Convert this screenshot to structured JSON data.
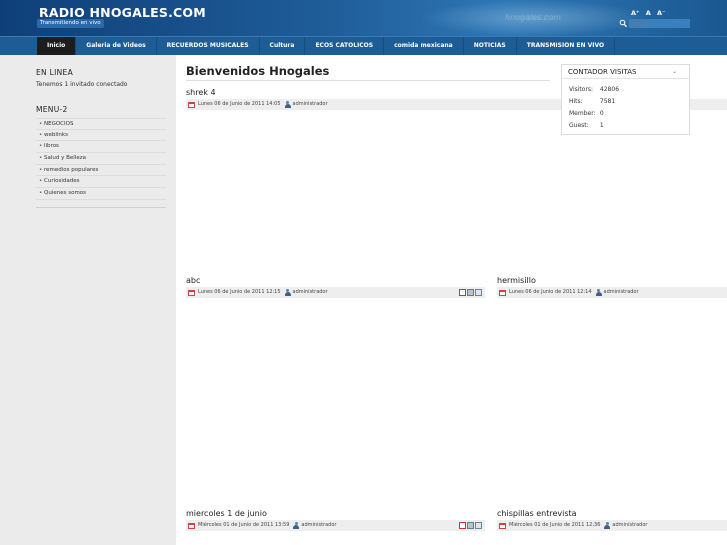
{
  "header": {
    "site_title": "RADIO HNOGALES.COM",
    "tagline": "Transmitiendo en vivo",
    "watermark": "hnogales.com",
    "font_sizer": [
      "A⁺",
      "A",
      "A⁻"
    ],
    "search_placeholder": "buscar...",
    "colors": {
      "header_dark": "#0f3f78",
      "header_light": "#2f77b5",
      "nav": "#1e5c96",
      "nav_active": "#1d1d1d"
    }
  },
  "nav": {
    "items": [
      {
        "label": "Inicio"
      },
      {
        "label": "Galeria de Videos"
      },
      {
        "label": "RECUERDOS MUSICALES"
      },
      {
        "label": "Cultura"
      },
      {
        "label": "ECOS CATOLICOS"
      },
      {
        "label": "comida mexicana"
      },
      {
        "label": "NOTICIAS"
      },
      {
        "label": "TRANSMISION EN VIVO"
      }
    ]
  },
  "sidebar": {
    "online_heading": "EN LINEA",
    "online_text": "Tenemos 1 invitado conectado",
    "menu_heading": "MENU-2",
    "menu_items": [
      {
        "label": "NEGOCIOS"
      },
      {
        "label": "weblinks"
      },
      {
        "label": "libros"
      },
      {
        "label": "Salud y Belleza"
      },
      {
        "label": "remedios populares"
      },
      {
        "label": "Curiosidades"
      },
      {
        "label": "Quienes somos"
      }
    ]
  },
  "main": {
    "page_title": "Bienvenidos Hnogales",
    "articles": [
      {
        "title": "shrek 4",
        "date": "Lunes 06 de Junio de 2011 14:05",
        "author": "administrador"
      },
      {
        "title": "abc",
        "date": "Lunes 06 de Junio de 2011 12:15",
        "author": "administrador"
      },
      {
        "title": "hermisillo",
        "date": "Lunes 06 de Junio de 2011 12:14",
        "author": "administrador"
      },
      {
        "title": "miercoles 1 de junio",
        "date": "Miércoles 01 de Junio de 2011 13:59",
        "author": "administrador"
      },
      {
        "title": "chispillas entrevista",
        "date": "Miércoles 01 de Junio de 2011 12:36",
        "author": "administrador"
      }
    ]
  },
  "counter": {
    "title": "CONTADOR VISITAS",
    "collapse_icon": "chevron-icon",
    "rows": [
      {
        "label": "Visitors:",
        "value": "42806"
      },
      {
        "label": "Hits:",
        "value": "7581"
      },
      {
        "label": "Member:",
        "value": "0"
      },
      {
        "label": "Guest:",
        "value": "1"
      }
    ]
  }
}
